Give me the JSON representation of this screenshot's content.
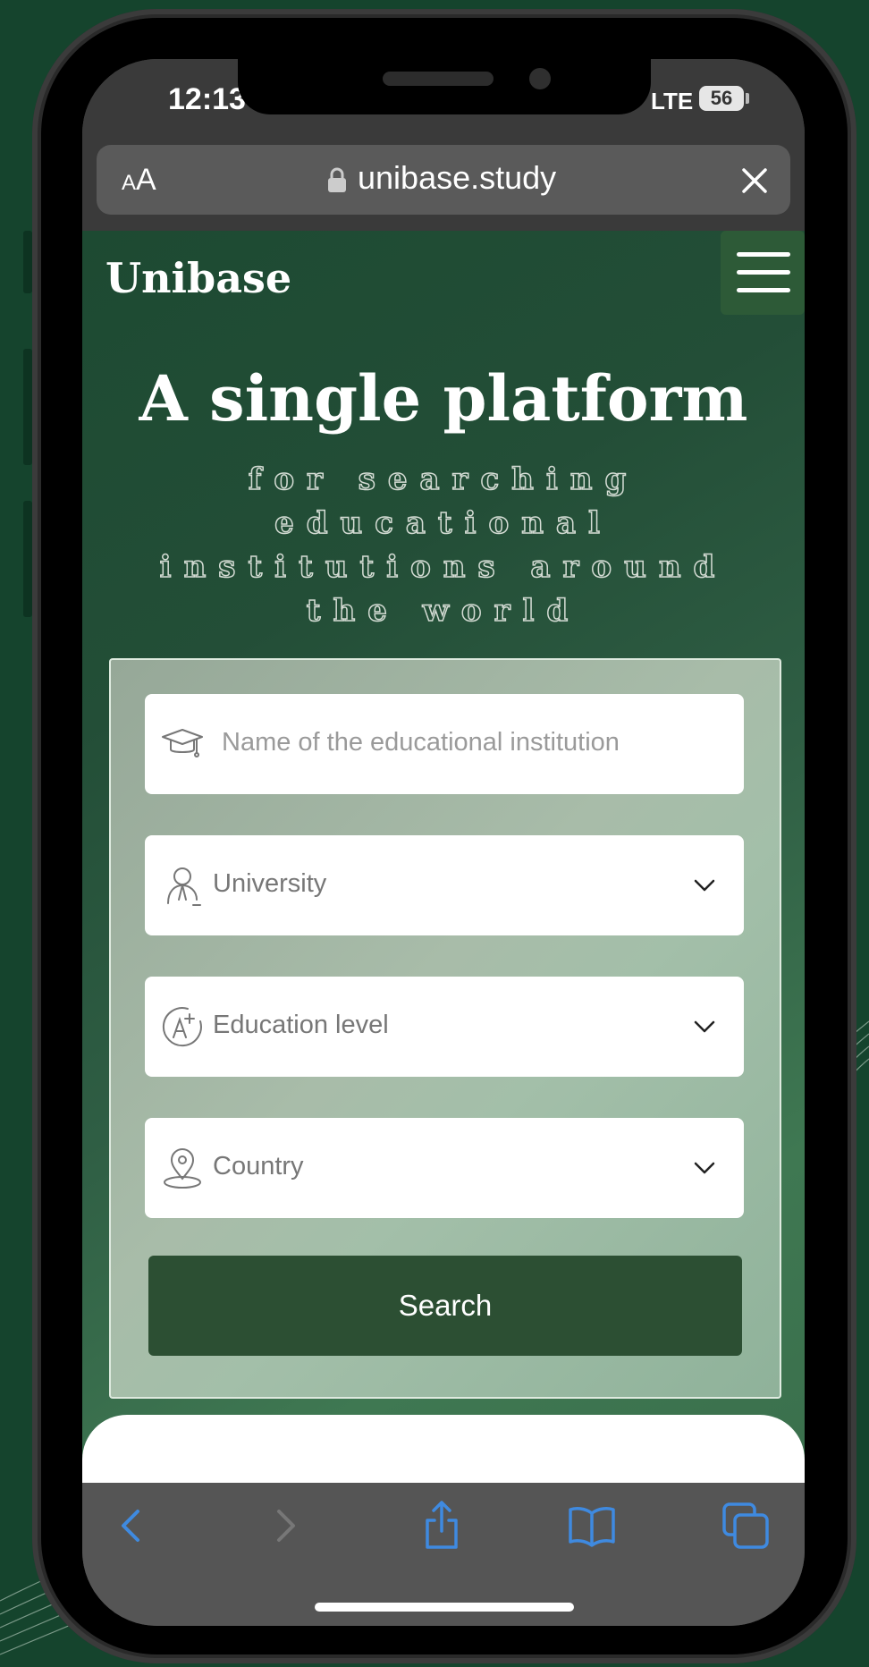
{
  "status_bar": {
    "time": "12:13",
    "network": "LTE",
    "battery": "56"
  },
  "browser": {
    "text_size_label_small": "A",
    "text_size_label_large": "A",
    "url": "unibase.study"
  },
  "header": {
    "logo": "Unibase"
  },
  "hero": {
    "title": "A single platform",
    "subtitle": "for searching educational institutions around the world"
  },
  "search_form": {
    "institution_field": {
      "placeholder": "Name of the educational institution",
      "icon": "graduation-cap-icon"
    },
    "type_select": {
      "value": "University",
      "icon": "person-icon"
    },
    "level_select": {
      "value": "Education level",
      "icon": "grade-a-plus-icon"
    },
    "country_select": {
      "value": "Country",
      "icon": "location-pin-icon"
    },
    "search_label": "Search"
  },
  "toolbar": {
    "items": [
      "back-icon",
      "forward-icon",
      "share-icon",
      "bookmarks-icon",
      "tabs-icon"
    ]
  },
  "colors": {
    "brand_green": "#2c4f33",
    "safari_blue": "#3f8ae0",
    "background": "#15442d"
  }
}
